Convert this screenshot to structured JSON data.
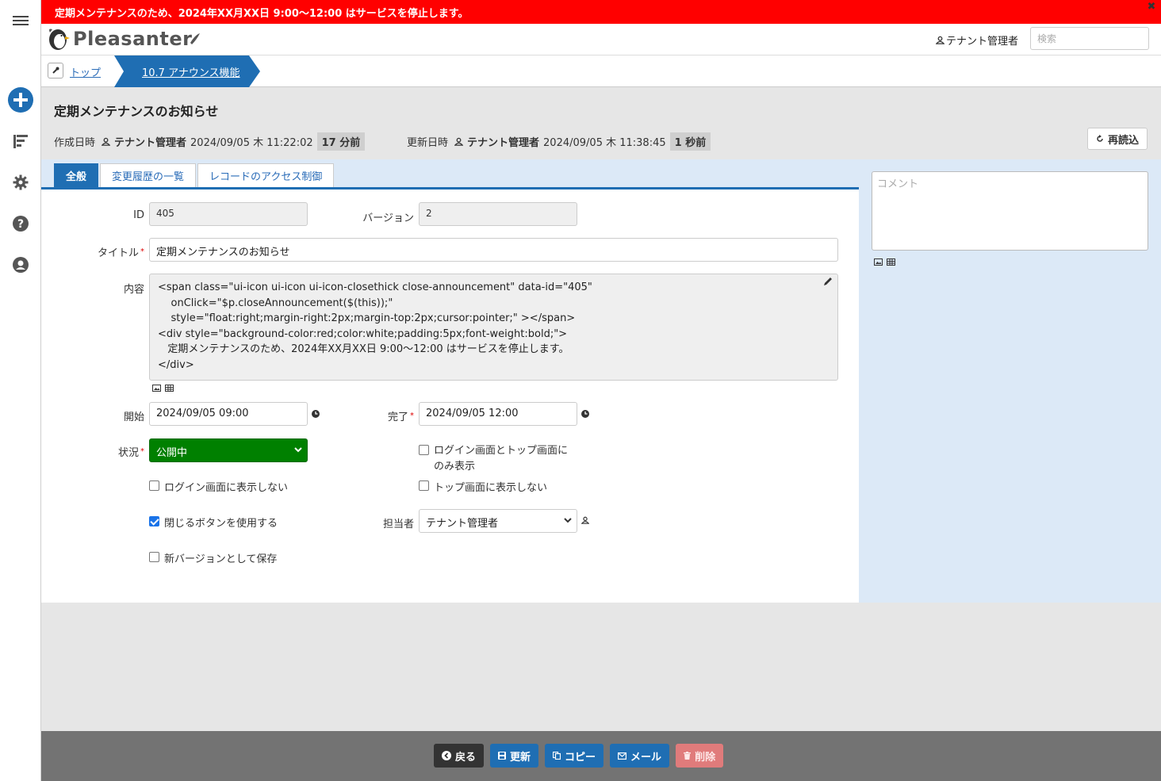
{
  "announcement": {
    "text": "定期メンテナンスのため、2024年XX月XX日 9:00～12:00 はサービスを停止します。",
    "close_glyph": "✖"
  },
  "header": {
    "logo_text": "Pleasanter",
    "user": "テナント管理者",
    "search_placeholder": "検索"
  },
  "breadcrumb": {
    "top": "トップ",
    "current": "10.7 アナウンス機能"
  },
  "page": {
    "title": "定期メンテナンスのお知らせ",
    "created_label": "作成日時",
    "created_by": "テナント管理者",
    "created_at": "2024/09/05 木 11:22:02",
    "created_ago": "17 分前",
    "updated_label": "更新日時",
    "updated_by": "テナント管理者",
    "updated_at": "2024/09/05 木 11:38:45",
    "updated_ago": "1 秒前",
    "reload_label": "再読込"
  },
  "tabs": [
    {
      "label": "全般",
      "active": true
    },
    {
      "label": "変更履歴の一覧",
      "active": false
    },
    {
      "label": "レコードのアクセス制御",
      "active": false
    }
  ],
  "form": {
    "id_label": "ID",
    "id_value": "405",
    "version_label": "バージョン",
    "version_value": "2",
    "title_label": "タイトル",
    "title_value": "定期メンテナンスのお知らせ",
    "body_label": "内容",
    "body_value": "<span class=\"ui-icon ui-icon ui-icon-closethick close-announcement\" data-id=\"405\"\n    onClick=\"$p.closeAnnouncement($(this));\"\n    style=\"float:right;margin-right:2px;margin-top:2px;cursor:pointer;\" ></span>\n<div style=\"background-color:red;color:white;padding:5px;font-weight:bold;\">\n   定期メンテナンスのため、2024年XX月XX日 9:00～12:00 はサービスを停止します。\n</div>",
    "start_label": "開始",
    "start_value": "2024/09/05 09:00",
    "end_label": "完了",
    "end_value": "2024/09/05 12:00",
    "status_label": "状況",
    "status_value": "公開中",
    "status_color": "#008000",
    "cb_login_top_only": "ログイン画面とトップ画面にのみ表示",
    "cb_login_top_only_line1": "ログイン画面とトップ画面に",
    "cb_login_top_only_line2": "のみ表示",
    "cb_hide_login": "ログイン画面に表示しない",
    "cb_hide_top": "トップ画面に表示しない",
    "cb_use_close": "閉じるボタンを使用する",
    "cb_use_close_checked": true,
    "manager_label": "担当者",
    "manager_value": "テナント管理者",
    "cb_new_version": "新バージョンとして保存"
  },
  "comment": {
    "placeholder": "コメント"
  },
  "footer": {
    "back": "戻る",
    "update": "更新",
    "copy": "コピー",
    "mail": "メール",
    "delete": "削除"
  },
  "colors": {
    "announce_bg": "#ff0000",
    "primary": "#1f6eb3",
    "status_green": "#008000",
    "delete": "#e07b7b"
  }
}
